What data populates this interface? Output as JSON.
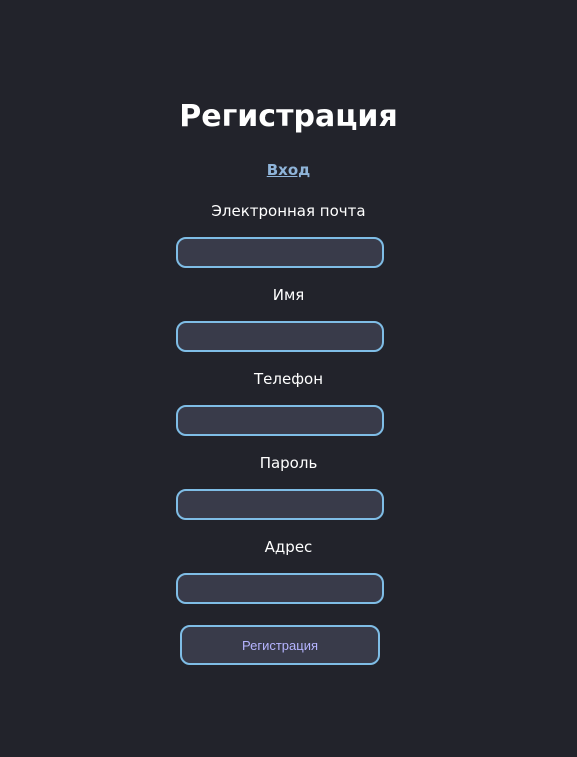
{
  "page": {
    "title": "Регистрация",
    "login_link": "Вход"
  },
  "fields": [
    {
      "label": "Электронная почта",
      "value": "",
      "placeholder": ""
    },
    {
      "label": "Имя",
      "value": "",
      "placeholder": ""
    },
    {
      "label": "Телефон",
      "value": "",
      "placeholder": ""
    },
    {
      "label": "Пароль",
      "value": "",
      "placeholder": ""
    },
    {
      "label": "Адрес",
      "value": "",
      "placeholder": ""
    }
  ],
  "submit": {
    "label": "Регистрация"
  },
  "colors": {
    "background": "#22232b",
    "input_background": "#393b4a",
    "accent_border": "#7fbde6",
    "link": "#8fb4d9",
    "button_text": "#b5b4ff"
  }
}
